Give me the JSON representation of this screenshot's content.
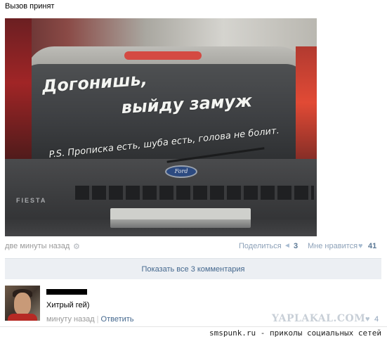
{
  "post": {
    "text": "Вызов принят",
    "image_text": {
      "line1": "Догонишь,",
      "line2": "выйду замуж",
      "line3": "P.S. Прописка есть, шуба есть, голова не болит."
    },
    "car_badge": "FIESTA",
    "logo_text": "Ford",
    "time": "две минуты назад",
    "share_label": "Поделиться",
    "share_count": "3",
    "like_label": "Мне нравится",
    "like_count": "41"
  },
  "comments": {
    "show_all_label": "Показать все 3 комментария",
    "items": [
      {
        "text": "Хитрый гей)",
        "time": "минуту назад",
        "reply_label": "Ответить",
        "likes": "4"
      }
    ]
  },
  "watermark": "YAPLAKAL.COM",
  "footer": "smspunk.ru - приколы социальных сетей",
  "icons": {
    "settings": "gear-icon",
    "share": "megaphone-icon",
    "like": "heart-icon"
  },
  "colors": {
    "link": "#45688e",
    "muted": "#999999",
    "counter": "#5b7895",
    "panel": "#eceff3"
  }
}
